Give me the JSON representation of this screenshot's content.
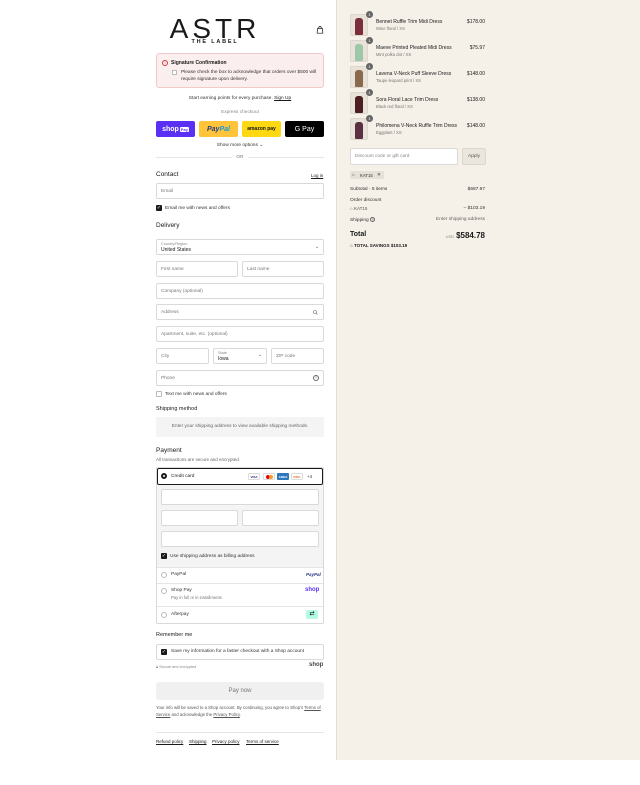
{
  "brand": {
    "name": "ASTR",
    "tagline": "THE LABEL"
  },
  "notice": {
    "title": "Signature Confirmation",
    "text": "Please check the box to acknowledge that orders over $500 will require signature upon delivery."
  },
  "earn": {
    "text": "Start earning points for every purchase.",
    "link": "Sign Up"
  },
  "express": {
    "label": "Express checkout",
    "buttons": {
      "shop": "shop",
      "shop_badge": "Pay",
      "paypal_a": "Pay",
      "paypal_b": "Pal",
      "amazon": "amazon pay",
      "gpay": "G Pay"
    },
    "show_more": "Show more options",
    "or": "OR"
  },
  "contact": {
    "title": "Contact",
    "login": "Log in",
    "email_placeholder": "Email",
    "email_news": "Email me with news and offers"
  },
  "delivery": {
    "title": "Delivery",
    "country_label": "Country/Region",
    "country_value": "United States",
    "first_name": "First name",
    "last_name": "Last name",
    "company": "Company (optional)",
    "address": "Address",
    "apartment": "Apartment, suite, etc. (optional)",
    "city": "City",
    "state_label": "State",
    "state_value": "Iowa",
    "zip": "ZIP code",
    "phone": "Phone",
    "text_news": "Text me with news and offers"
  },
  "shipping": {
    "title": "Shipping method",
    "message": "Enter your shipping address to view available shipping methods."
  },
  "payment": {
    "title": "Payment",
    "subtitle": "All transactions are secure and encrypted.",
    "credit_card": "Credit card",
    "card_brands": [
      "VISA",
      "MC",
      "AMEX",
      "DISC"
    ],
    "more_cards": "+4",
    "billing_same": "Use shipping address as billing address",
    "paypal": "PayPal",
    "paypal_logo": "PayPal",
    "shop_pay": "Shop Pay",
    "shop_pay_sub": "Pay in full or in installments",
    "shop_logo": "shop",
    "afterpay": "Afterpay"
  },
  "remember": {
    "title": "Remember me",
    "save_label": "Save my information for a faster checkout with a Shop account",
    "secure": "Secure and encrypted",
    "shop_logo": "shop"
  },
  "pay_now": "Pay now",
  "fine_print": {
    "line1": "Your info will be saved to a Shop account. By continuing, you agree to Shop's",
    "terms": "Terms of Service",
    "mid": "and acknowledge the",
    "privacy": "Privacy Policy",
    "end": "."
  },
  "footer": [
    "Refund policy",
    "Shipping",
    "Privacy policy",
    "Terms of service"
  ],
  "cart": {
    "items": [
      {
        "qty": "1",
        "name": "Bennet Ruffle Trim Midi Dress",
        "variant": "Wine floral / XS",
        "price": "$178.00",
        "color": "#7a2e3a"
      },
      {
        "qty": "1",
        "name": "Maeve Printed Pleated Midi Dress",
        "variant": "Mint polka dot / XS",
        "price": "$75.97",
        "color": "#9cc7a8"
      },
      {
        "qty": "1",
        "name": "Lavena V-Neck Puff Sleeve Dress",
        "variant": "Taupe leopard print / XS",
        "price": "$148.00",
        "color": "#8a6a4c"
      },
      {
        "qty": "1",
        "name": "Sora Floral Lace Trim Dress",
        "variant": "Black red floral / XS",
        "price": "$138.00",
        "color": "#4a1e22"
      },
      {
        "qty": "1",
        "name": "Philomena V-Neck Ruffle Trim Dress",
        "variant": "Eggplant / XS",
        "price": "$148.00",
        "color": "#5a3040"
      }
    ],
    "discount_placeholder": "Discount code or gift card",
    "apply": "Apply",
    "code": "KAT15",
    "subtotal_label": "Subtotal · 5 items",
    "subtotal": "$687.97",
    "order_discount_label": "Order discount",
    "order_discount_code": "KAT15",
    "order_discount": "– $103.19",
    "shipping_label": "Shipping",
    "shipping_value": "Enter shipping address",
    "total_label": "Total",
    "currency": "USD",
    "total": "$584.78",
    "savings_label": "TOTAL SAVINGS",
    "savings": "$103.19"
  }
}
